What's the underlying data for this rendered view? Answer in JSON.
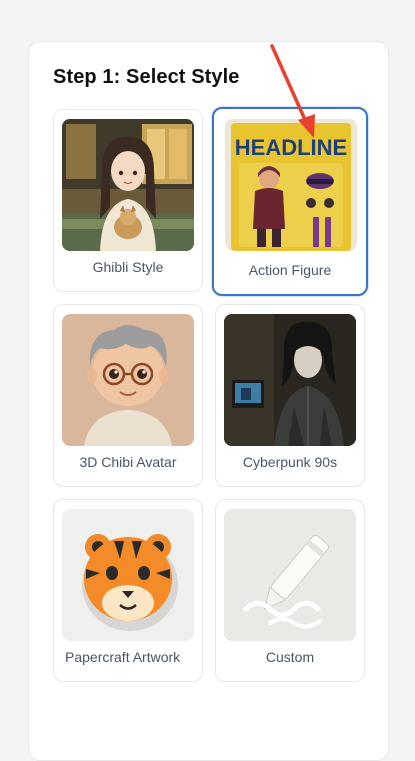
{
  "heading": "Step 1: Select Style",
  "selected_style": "Action Figure",
  "accent_color": "#3b73c8",
  "annotation_arrow_color": "#e8402e",
  "thumbnail_text": {
    "headline": "HEADLINE"
  },
  "styles": [
    {
      "label": "Ghibli Style",
      "selected": false
    },
    {
      "label": "Action Figure",
      "selected": true
    },
    {
      "label": "3D Chibi Avatar",
      "selected": false
    },
    {
      "label": "Cyberpunk 90s",
      "selected": false
    },
    {
      "label": "Papercraft Artwork",
      "selected": false
    },
    {
      "label": "Custom",
      "selected": false
    }
  ]
}
